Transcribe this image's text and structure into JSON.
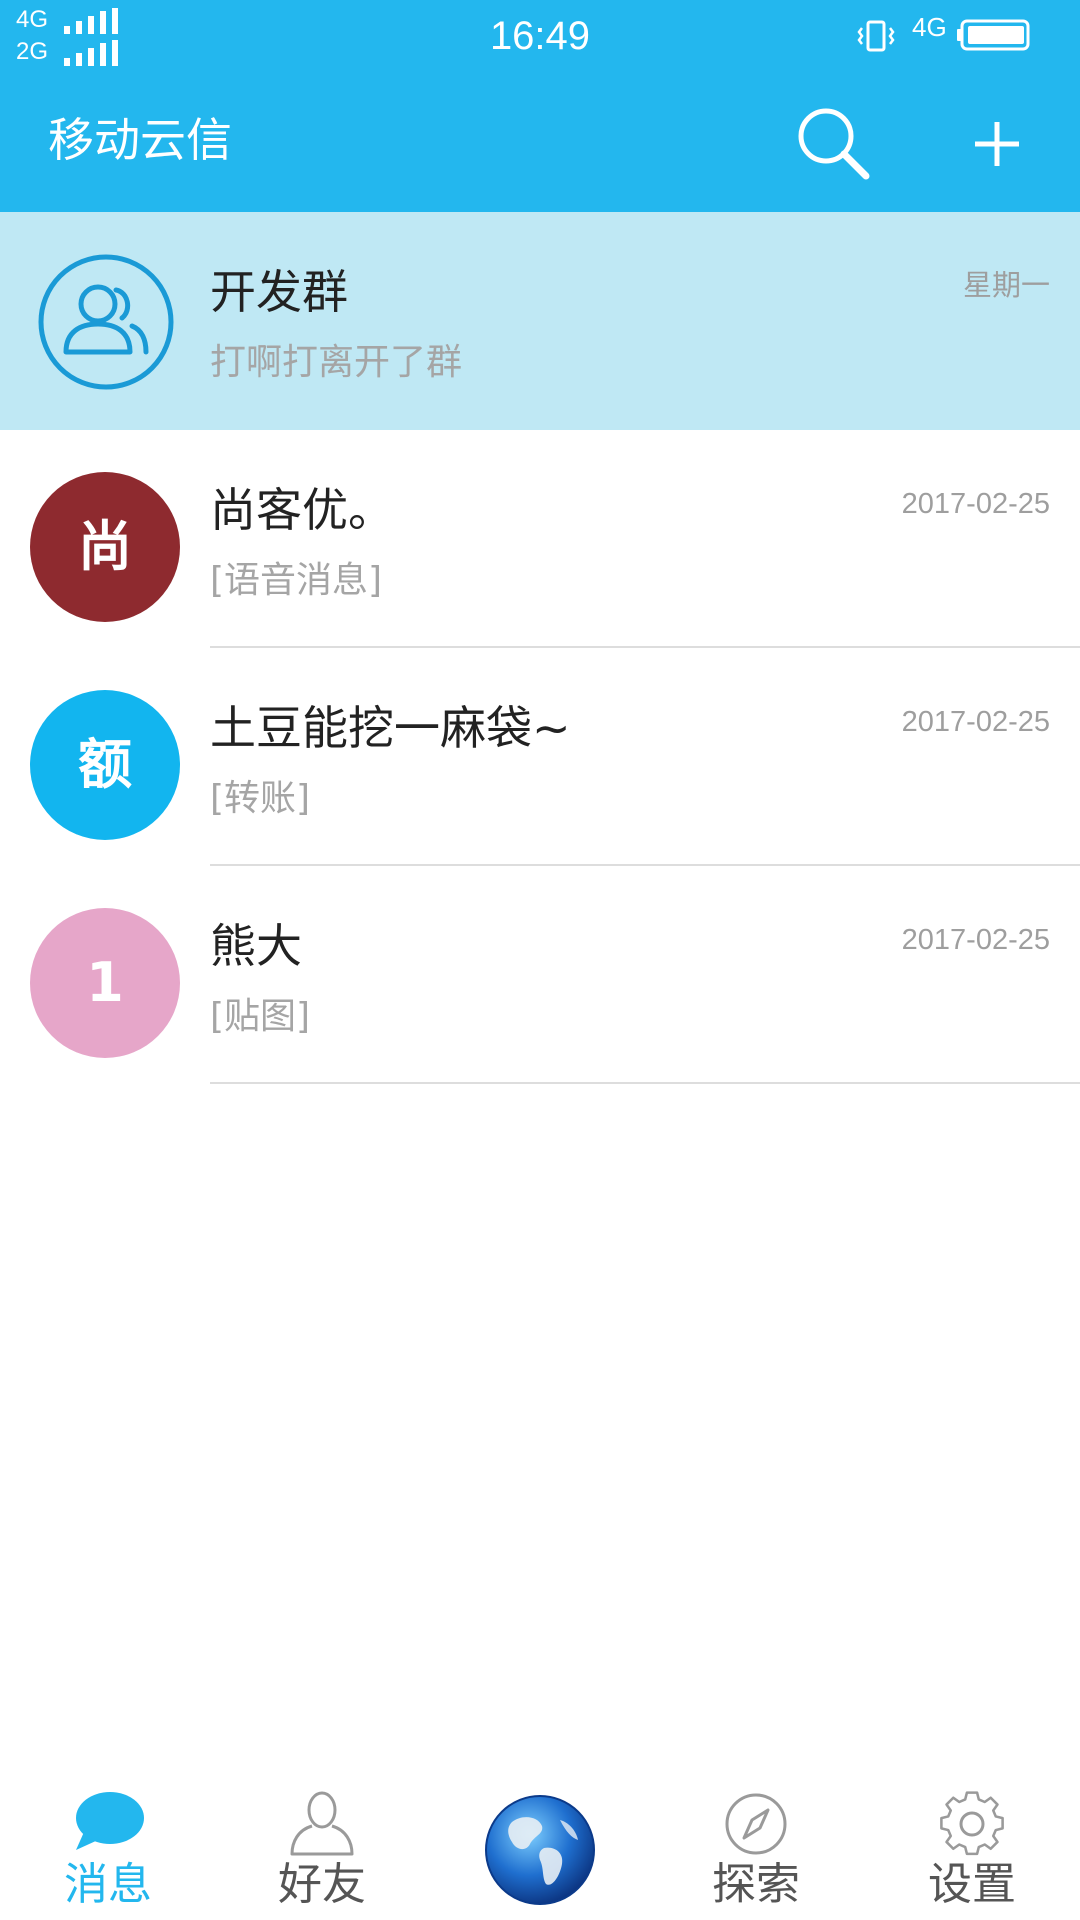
{
  "status_bar": {
    "sim1_network": "4G",
    "sim2_network": "2G",
    "time": "16:49",
    "data_network": "4G"
  },
  "app_bar": {
    "title": "移动云信",
    "search_icon": "search-icon",
    "add_icon": "plus-icon"
  },
  "conversations": [
    {
      "name": "开发群",
      "preview": "打啊打离开了群",
      "time": "星期一",
      "avatar_text": "",
      "avatar_icon": "group-icon",
      "avatar_color": "#1a9ad6",
      "pinned": true
    },
    {
      "name": "尚客优。",
      "preview": "[语音消息]",
      "time": "2017-02-25",
      "avatar_text": "尚",
      "avatar_color": "#8e2a2f",
      "pinned": false
    },
    {
      "name": "土豆能挖一麻袋~",
      "preview": "[转账]",
      "time": "2017-02-25",
      "avatar_text": "额",
      "avatar_color": "#12b5ef",
      "pinned": false
    },
    {
      "name": "熊大",
      "preview": "[贴图]",
      "time": "2017-02-25",
      "avatar_text": "1",
      "avatar_color": "#e6a6c9",
      "pinned": false
    }
  ],
  "bottom_nav": {
    "active": "messages",
    "items": [
      {
        "id": "messages",
        "label": "消息",
        "icon": "chat-bubble-icon"
      },
      {
        "id": "friends",
        "label": "好友",
        "icon": "person-icon"
      },
      {
        "id": "center",
        "label": "",
        "icon": "globe-icon"
      },
      {
        "id": "explore",
        "label": "探索",
        "icon": "compass-icon"
      },
      {
        "id": "settings",
        "label": "设置",
        "icon": "gear-icon"
      }
    ]
  },
  "colors": {
    "brand": "#23b7ee",
    "pinned_bg": "#bfe8f4",
    "divider": "#dddddd",
    "muted_text": "#a5a5a5"
  }
}
